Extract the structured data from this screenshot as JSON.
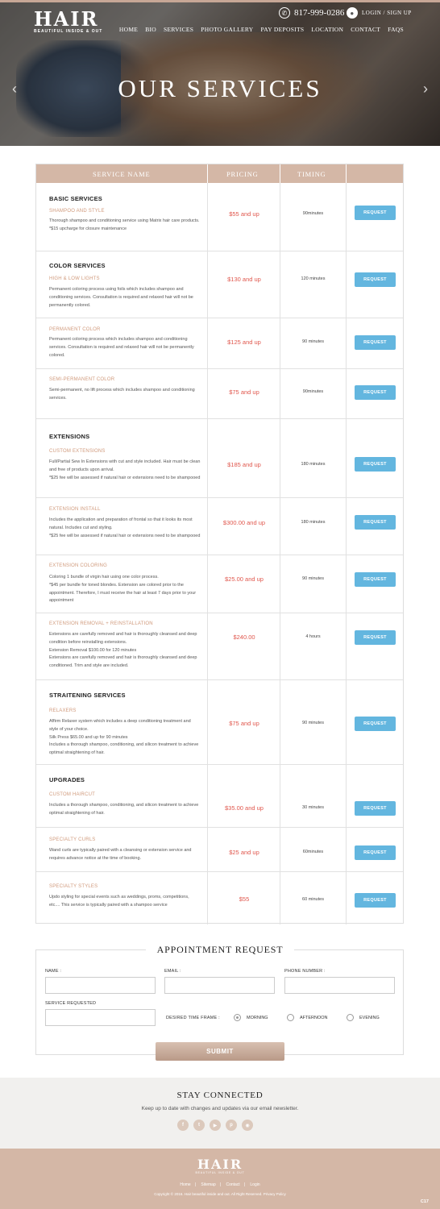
{
  "header": {
    "logo": "HAIR",
    "tagline": "BEAUTIFUL INSIDE & OUT",
    "phone": "817-999-0286",
    "login": "LOGIN / SIGN UP",
    "nav": [
      "HOME",
      "BIO",
      "SERVICES",
      "PHOTO GALLERY",
      "PAY DEPOSITS",
      "LOCATION",
      "CONTACT",
      "FAQS"
    ],
    "hero_title": "OUR SERVICES",
    "prev_arrow": "‹",
    "next_arrow": "›"
  },
  "table": {
    "headers": [
      "SERVICE NAME",
      "PRICING",
      "TIMING"
    ],
    "request_label": "REQUEST",
    "categories": [
      "BASIC SERVICES",
      "COLOR SERVICES",
      "EXTENSIONS",
      "STRAITENING SERVICES",
      "UPGRADES"
    ],
    "services": [
      {
        "name": "SHAMPOO AND STYLE",
        "desc": "Thorough shampoo and conditioning service using Matrix hair care products.\n*$15 upcharge for closure maintenance",
        "price": "$55 and up",
        "timing": "90minutes"
      },
      {
        "name": "HIGH & LOW LIGHTS",
        "desc": "Permanent coloring process using foils which includes shampoo and conditioning services.  Consultation is required and relaxed hair will not be permanently colored.",
        "price": "$130 and up",
        "timing": "120 minutes"
      },
      {
        "name": "PERMANENT COLOR",
        "desc": "Permanent coloring process which includes shampoo and conditioning services.  Consultation is required and relaxed hair will not be permanently colored.",
        "price": "$125 and up",
        "timing": "90 minutes"
      },
      {
        "name": "SEMI-PERMANENT COLOR",
        "desc": "Semi-permanent, no lift process which includes shampoo and conditioning services.",
        "price": "$75 and up",
        "timing": "90minutes"
      },
      {
        "name": "CUSTOM EXTENSIONS",
        "desc": "Full/Partial Sew In Extensions with cut and style included.  Hair must be clean and free of products upon arrival.\n*$25 fee will be assessed if natural hair or extensions need to be shampooed",
        "price": "$185 and up",
        "timing": "180 minutes"
      },
      {
        "name": "EXTENSION INSTALL",
        "desc": "Includes the application and preparation of frontal so that it looks its most natural.  Includes cut and styling.\n*$25 fee will be assessed if natural hair or extensions need to be shampooed",
        "price": "$300.00 and up",
        "timing": "180 minutes"
      },
      {
        "name": "EXTENSION COLORING",
        "desc": "Coloring 1 bundle of virgin hair using one color process.\n*$45 per bundle for toned blondes.  Extension are colored prior to the appointment.  Therefore, I must receive the hair at least 7 days prior to your appointment",
        "price": "$25.00 and up",
        "timing": "90 minutes"
      },
      {
        "name": "EXTENSION REMOVAL + REINSTALLATION",
        "desc": "Extensions are carefully removed and hair is thoroughly cleansed and deep condition before reinstalling extensions.\nExtension Removal $100.00 for 120 minutes\nExtensions are carefully removed and hair is thoroughly cleansed and deep conditioned.  Trim and style are included.",
        "price": "$240.00",
        "timing": "4 hours"
      },
      {
        "name": "RELAXERS",
        "desc": "Affirm Relaxer system which includes a deep conditioning treatment and style of your choice.\nSilk Press $65.00 and up for 90 minutes\nIncludes a thorough shampoo, conditioning, and silicon treatment to achieve optimal straightening of hair.",
        "price": "$75 and up",
        "timing": "90 minutes"
      },
      {
        "name": "CUSTOM HAIRCUT",
        "desc": "Includes a thorough shampoo, conditioning, and silicon treatment to achieve optimal straightening of hair.",
        "price": "$35.00 and up",
        "timing": "30 minutes"
      },
      {
        "name": "SPECIALTY CURLS",
        "desc": "Wand curls are typically paired with a cleansing or extension service and requires advance notice at the time of booking.",
        "price": "$25 and up",
        "timing": "60minutes"
      },
      {
        "name": "SPECIALTY STYLES",
        "desc": "Updo styling for special events such as weddings, proms, competitions, etc....  This service is typically paired with a shampoo service",
        "price": "$55",
        "timing": "60 minutes"
      }
    ]
  },
  "appointment": {
    "title": "APPOINTMENT REQUEST",
    "name_label": "NAME :",
    "email_label": "EMAIL :",
    "phone_label": "PHONE NUMBER :",
    "service_label": "SERVICE REQUESTED",
    "timeframe_label": "DESIRED TIME FRAME :",
    "options": [
      "MORNING",
      "AFTERNOON",
      "EVENING"
    ],
    "selected_option": "MORNING",
    "submit": "SUBMIT"
  },
  "stay": {
    "title": "STAY CONNECTED",
    "text": "Keep up to date with changes and updates via our email newsletter.",
    "socials": [
      "facebook-icon",
      "twitter-icon",
      "youtube-icon",
      "pinterest-icon",
      "rss-icon"
    ]
  },
  "footer": {
    "logo": "HAIR",
    "tagline": "BEAUTIFUL INSIDE & OUT",
    "links": [
      "Home",
      "Sitemap",
      "Contact",
      "Login"
    ],
    "copyright": "Copyright © 2016. Hair beautiful inside and out. All Right Reserved. Privacy Policy",
    "badge": "C17"
  },
  "colors": {
    "accent": "#d4b7a6",
    "price": "#e0574d",
    "button": "#63b6df",
    "service_name": "#d09a7c"
  }
}
